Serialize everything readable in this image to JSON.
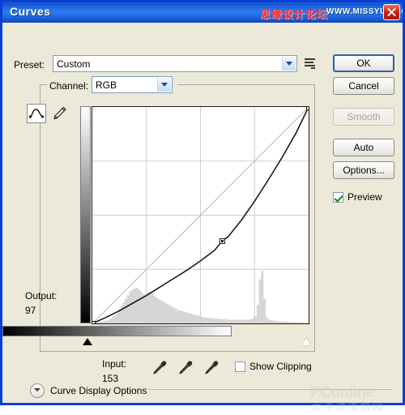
{
  "window": {
    "title": "Curves",
    "close_icon": "close-icon",
    "watermark_forum": "思缘设计论坛",
    "watermark_url": "WWW.MISSYUAN.COM",
    "watermark_bottom_brand": "PConline",
    "watermark_bottom_cn": "太平洋电脑网"
  },
  "preset": {
    "label": "Preset:",
    "value": "Custom",
    "menu_icon": "preset-menu-icon"
  },
  "channel": {
    "label": "Channel:",
    "value": "RGB"
  },
  "tools": {
    "curve_point_icon": "curve-point-tool-icon",
    "pencil_icon": "pencil-tool-icon",
    "eyedropper_black_icon": "eyedropper-black-point-icon",
    "eyedropper_gray_icon": "eyedropper-gray-point-icon",
    "eyedropper_white_icon": "eyedropper-white-point-icon"
  },
  "readout": {
    "output_label": "Output:",
    "output_value": "97",
    "input_label": "Input:",
    "input_value": "153"
  },
  "checkboxes": {
    "show_clipping": {
      "label": "Show Clipping",
      "checked": false
    },
    "preview": {
      "label": "Preview",
      "checked": true
    }
  },
  "buttons": {
    "ok": "OK",
    "cancel": "Cancel",
    "smooth": "Smooth",
    "auto": "Auto",
    "options": "Options..."
  },
  "curve_display_options": {
    "label": "Curve Display Options",
    "expanded": false,
    "chevron_icon": "chevron-down-icon"
  },
  "colors": {
    "titlebar_blue": "#1d68e0",
    "dialog_border": "#0a3fd6",
    "dialog_face": "#ece9d8",
    "curve_line": "#1a1a1a",
    "baseline": "#b8b8b8",
    "grid": "#cfcfcf",
    "histogram": "#d6d6d6",
    "check_green": "#0a8a20",
    "close_red": "#d82410"
  },
  "chart_data": {
    "type": "line",
    "title": "Curves (RGB)",
    "xlabel": "Input",
    "ylabel": "Output",
    "xlim": [
      0,
      255
    ],
    "ylim": [
      0,
      255
    ],
    "grid": true,
    "grid_divisions": 4,
    "legend": "none",
    "series": [
      {
        "name": "baseline",
        "style": "diagonal-reference",
        "color": "#b8b8b8",
        "x": [
          0,
          255
        ],
        "y": [
          0,
          255
        ]
      },
      {
        "name": "rgb-curve",
        "style": "solid",
        "color": "#1a1a1a",
        "control_points": [
          {
            "input": 0,
            "output": 0
          },
          {
            "input": 153,
            "output": 97
          },
          {
            "input": 255,
            "output": 255
          }
        ],
        "x": [
          0,
          16,
          32,
          48,
          64,
          80,
          96,
          112,
          128,
          144,
          153,
          160,
          176,
          192,
          208,
          224,
          240,
          255
        ],
        "y": [
          0,
          7,
          15,
          24,
          33,
          43,
          53,
          63,
          74,
          86,
          97,
          102,
          122,
          145,
          170,
          196,
          224,
          255
        ]
      }
    ],
    "histogram": {
      "name": "input-histogram",
      "color": "#d6d6d6",
      "bins": [
        2,
        2,
        2,
        3,
        3,
        4,
        5,
        6,
        8,
        10,
        13,
        17,
        22,
        28,
        34,
        40,
        46,
        52,
        55,
        57,
        58,
        56,
        52,
        48,
        47,
        50,
        52,
        50,
        46,
        42,
        40,
        38,
        36,
        34,
        32,
        30,
        28,
        26,
        24,
        22,
        21,
        20,
        19,
        18,
        17,
        16,
        15,
        14,
        13,
        12,
        11,
        10,
        10,
        9,
        9,
        8,
        8,
        8,
        7,
        7,
        7,
        7,
        6,
        6,
        6,
        6,
        6,
        6,
        6,
        6,
        6,
        6,
        6,
        7,
        8,
        12,
        30,
        72,
        86,
        40,
        10,
        6,
        5,
        5,
        4,
        4,
        4,
        3,
        3,
        3,
        3,
        2,
        2,
        2,
        2,
        2,
        2,
        1,
        1,
        1
      ]
    },
    "markers": {
      "selected_point": {
        "input": 153,
        "output": 97
      },
      "endpoints": [
        {
          "input": 0,
          "output": 0
        },
        {
          "input": 255,
          "output": 255
        }
      ]
    },
    "sliders": {
      "black_point": 0,
      "white_point": 255
    }
  }
}
